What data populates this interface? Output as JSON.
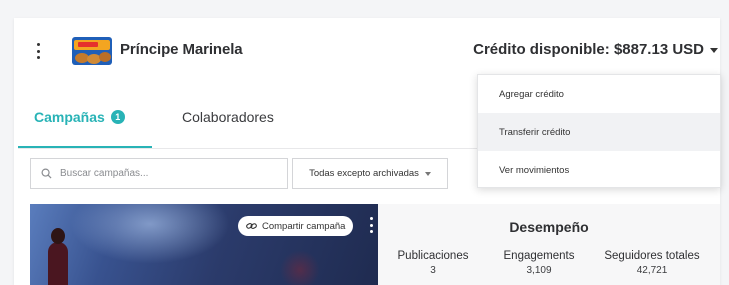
{
  "header": {
    "brand_name": "Príncipe Marinela",
    "credit_label": "Crédito disponible: $887.13 USD",
    "brand_logo_icon": "principe-marinela-package-logo"
  },
  "tabs": [
    {
      "label": "Campañas",
      "badge": "1",
      "active": true
    },
    {
      "label": "Colaboradores",
      "active": false
    }
  ],
  "filters": {
    "search_placeholder": "Buscar campañas...",
    "status_filter": "Todas excepto archivadas"
  },
  "campaign": {
    "share_label": "Compartir campaña",
    "performance": {
      "title": "Desempeño",
      "metrics": [
        {
          "label": "Publicaciones",
          "value": "3"
        },
        {
          "label": "Engagements",
          "value": "3,109"
        },
        {
          "label": "Seguidores totales",
          "value": "42,721"
        }
      ]
    }
  },
  "credit_menu": {
    "items": [
      "Agregar crédito",
      "Transferir crédito",
      "Ver movimientos"
    ],
    "hovered_index": 1
  },
  "colors": {
    "accent": "#28b3b6",
    "text": "#2f3033",
    "background": "#f4f5f7"
  }
}
